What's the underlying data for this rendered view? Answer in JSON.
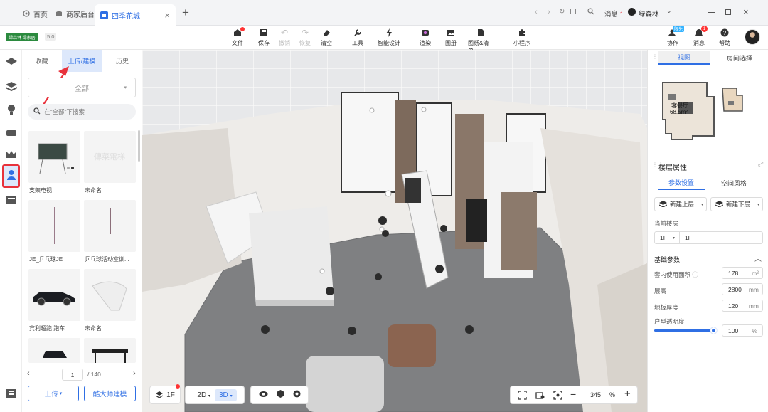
{
  "browser": {
    "tabs": [
      {
        "label": "首页",
        "icon": "home-icon"
      },
      {
        "label": "商家后台",
        "icon": "store-icon"
      },
      {
        "label": "四季花城",
        "icon": "app-icon",
        "active": true
      }
    ],
    "new_tab": "+",
    "close_tab": "×",
    "message_label": "消息",
    "message_count": "1",
    "user_name": "绿森林..."
  },
  "toolbar": {
    "logo_text": "绿森林 绿家居",
    "version": "5.0",
    "items": [
      {
        "label": "文件",
        "icon": "file-icon"
      },
      {
        "label": "保存",
        "icon": "save-icon"
      },
      {
        "label": "撤销",
        "icon": "undo-icon"
      },
      {
        "label": "恢复",
        "icon": "redo-icon"
      },
      {
        "label": "清空",
        "icon": "eraser-icon"
      },
      {
        "label": "工具",
        "icon": "wrench-icon"
      },
      {
        "label": "智能设计",
        "icon": "lightning-icon"
      },
      {
        "label": "渲染",
        "icon": "camera-icon"
      },
      {
        "label": "图册",
        "icon": "album-icon"
      },
      {
        "label": "图纸&清单",
        "icon": "document-icon"
      },
      {
        "label": "小程序",
        "icon": "puzzle-icon"
      }
    ],
    "right": [
      {
        "label": "协作",
        "icon": "collab-icon",
        "badge": "限免"
      },
      {
        "label": "消息",
        "icon": "bell-icon",
        "badge": "1"
      },
      {
        "label": "帮助",
        "icon": "help-icon"
      }
    ]
  },
  "left_panel": {
    "tabs": [
      "收藏",
      "上传/建模",
      "历史"
    ],
    "filter_value": "全部",
    "search_placeholder": "在\"全部\"下搜索",
    "items": [
      {
        "label": "支架电视"
      },
      {
        "label": "未命名"
      },
      {
        "label": "JE_乒乓球JE"
      },
      {
        "label": "乒乓球活动室训..."
      },
      {
        "label": "宾利超跑 跑车"
      },
      {
        "label": "未命名"
      },
      {
        "label": ""
      },
      {
        "label": ""
      }
    ],
    "page_current": "1",
    "page_total": "/ 140",
    "upload_button": "上传",
    "modeling_button": "酷大师建模"
  },
  "viewport": {
    "floor_button": "1F",
    "mode_2d": "2D",
    "mode_3d": "3D",
    "zoom_value": "345",
    "zoom_unit": "%",
    "zoom_out": "−",
    "zoom_in": "+"
  },
  "right_panel": {
    "tabs": [
      "视图",
      "房间选择"
    ],
    "minimap_room_label": "客餐厅",
    "minimap_room_area": "68.5m²",
    "section_title": "楼层属性",
    "sub_tabs": [
      "参数设置",
      "空间风格"
    ],
    "new_upper": "新建上层",
    "new_lower": "新建下层",
    "current_floor_label": "当前楼层",
    "current_floor_select": "1F",
    "current_floor_value": "1F",
    "basic_params_title": "基础参数",
    "params": [
      {
        "label": "套内使用面积",
        "value": "178",
        "unit": "m²"
      },
      {
        "label": "层高",
        "value": "2800",
        "unit": "mm"
      },
      {
        "label": "地板厚度",
        "value": "120",
        "unit": "mm"
      }
    ],
    "opacity_label": "户型透明度",
    "opacity_value": "100",
    "opacity_unit": "%",
    "opacity_fraction": 1.0
  },
  "colors": {
    "accent": "#2f6fe4",
    "active_tab_bg": "#dde8fb",
    "highlight_red": "#e8323c"
  }
}
